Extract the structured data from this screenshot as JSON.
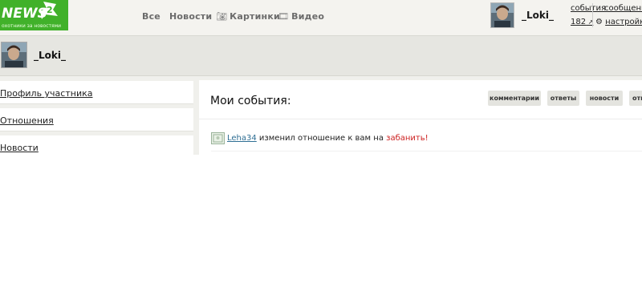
{
  "logo": {
    "text": "NEWS",
    "number": "2",
    "tagline": "охотники за новостями"
  },
  "nav": [
    {
      "label": "Все",
      "icon": ""
    },
    {
      "label": "Новости",
      "icon": ""
    },
    {
      "label": "Картинки",
      "icon": "camera-icon"
    },
    {
      "label": "Видео",
      "icon": "film-icon"
    }
  ],
  "user": {
    "name": "_Loki_",
    "links": {
      "events": "события",
      "messages": "сообщения",
      "rating": "182",
      "settings": "настройки"
    }
  },
  "sidebar": {
    "items": [
      {
        "label": "Профиль участника"
      },
      {
        "label": "Отношения"
      },
      {
        "label": "Новости"
      }
    ]
  },
  "main": {
    "title": "Мои события:",
    "filters": [
      "комментарии",
      "ответы",
      "новости",
      "отношения"
    ],
    "events": [
      {
        "user": "Leha34",
        "text": " изменил отношение к вам на ",
        "action": "забанить!"
      }
    ]
  },
  "colors": {
    "brand": "#41b12a",
    "link": "#2f6f94",
    "action": "#cc1f1f"
  }
}
